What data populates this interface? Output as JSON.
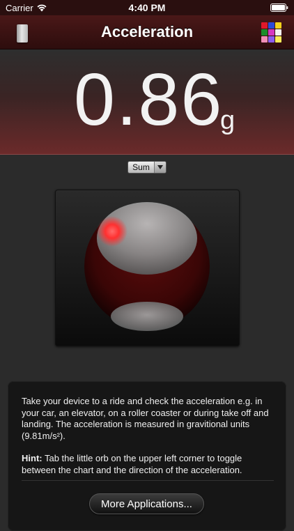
{
  "status_bar": {
    "carrier": "Carrier",
    "time": "4:40 PM",
    "wifi_icon": "wifi-icon",
    "battery_icon": "battery-icon"
  },
  "nav_bar": {
    "title": "Acceleration",
    "left_icon": "silver-toggle-icon",
    "right_icon": "color-grid-icon",
    "grid_colors": [
      "#e0182a",
      "#2a49d8",
      "#f2d21c",
      "#1c8d2b",
      "#d637c2",
      "#f2f2f2",
      "#f08fb8",
      "#8b5cf0",
      "#f6ec58"
    ]
  },
  "readout": {
    "value": "0.86",
    "unit": "g"
  },
  "mode_select": {
    "selected": "Sum",
    "arrow_icon": "triangle-down-icon"
  },
  "orb": {
    "indicator_color": "#ff3b3b",
    "sphere_color": "#6a0f0f"
  },
  "info": {
    "text": "Take your device to a ride and check the acceleration e.g. in your car, an elevator, on a roller coaster or during take off and landing. The acceleration is measured in gravitional units (9.81m/s²).",
    "hint_label": "Hint:",
    "hint_text": " Tab the little orb on the upper left corner to toggle between the chart and the direction of the acceleration.",
    "button_label": "More Applications..."
  },
  "colors": {
    "accent": "#4a1818",
    "background": "#2b2b2b"
  }
}
